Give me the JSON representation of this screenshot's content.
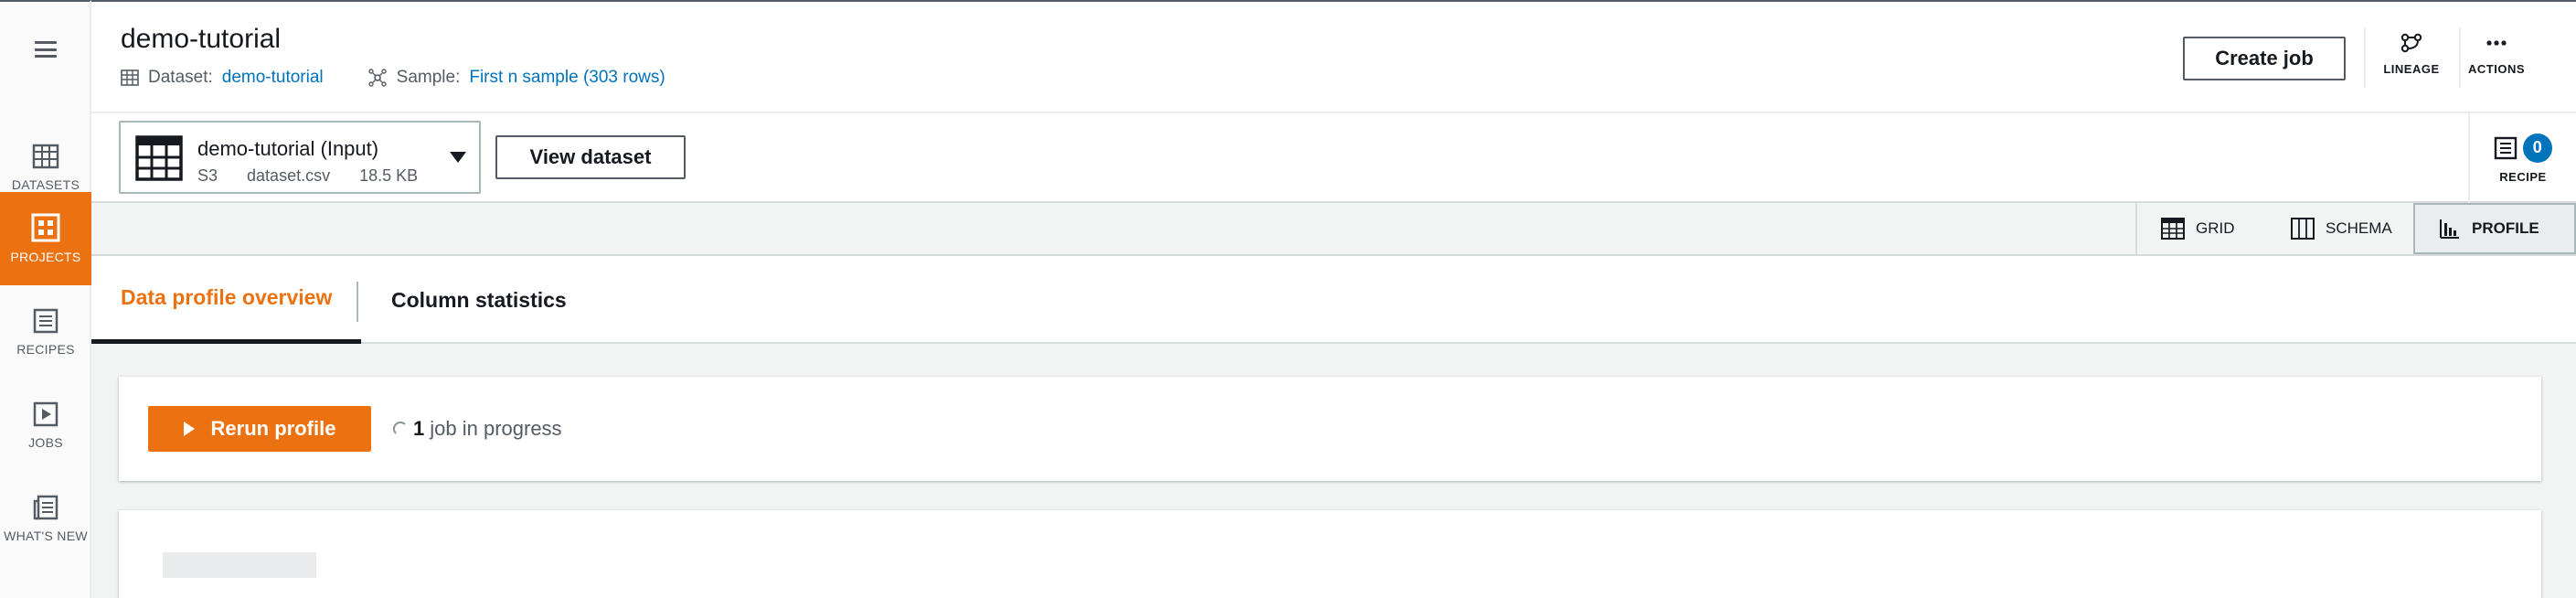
{
  "header": {
    "title": "demo-tutorial",
    "dataset_label": "Dataset:",
    "dataset_link": "demo-tutorial",
    "sample_label": "Sample:",
    "sample_link": "First n sample (303 rows)",
    "create_job": "Create job",
    "lineage": "LINEAGE",
    "actions": "ACTIONS"
  },
  "rail": {
    "items": [
      {
        "label": "DATASETS",
        "icon": "table-icon"
      },
      {
        "label": "PROJECTS",
        "icon": "projects-icon"
      },
      {
        "label": "RECIPES",
        "icon": "recipe-icon"
      },
      {
        "label": "JOBS",
        "icon": "play-icon"
      },
      {
        "label": "WHAT'S NEW",
        "icon": "news-icon"
      }
    ]
  },
  "dataset_bar": {
    "name": "demo-tutorial (Input)",
    "source": "S3",
    "file": "dataset.csv",
    "size": "18.5 KB",
    "view_dataset": "View dataset",
    "recipe_label": "RECIPE",
    "recipe_count": "0"
  },
  "view_tabs": [
    "GRID",
    "SCHEMA",
    "PROFILE"
  ],
  "content_tabs": [
    "Data profile overview",
    "Column statistics"
  ],
  "profile": {
    "rerun": "Rerun profile",
    "jobs_count": "1",
    "jobs_text": "job in progress"
  },
  "colors": {
    "accent": "#ec7211",
    "link": "#0073bb",
    "badge": "#0073bb"
  }
}
